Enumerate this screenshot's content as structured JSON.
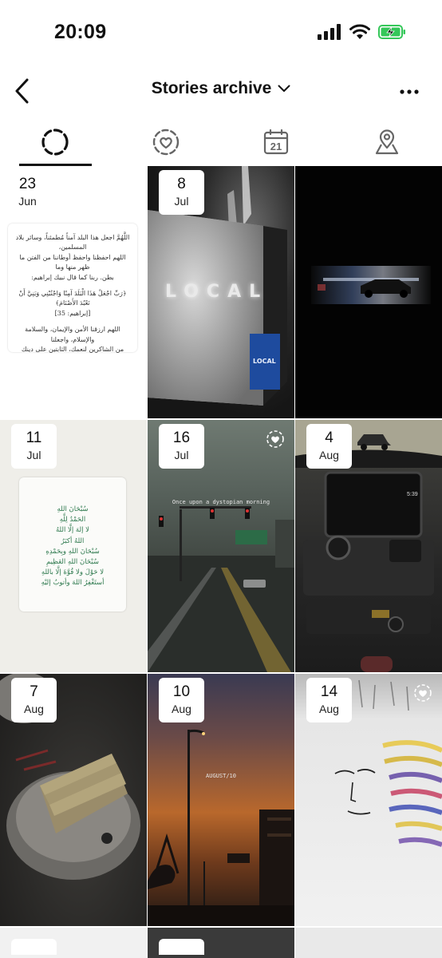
{
  "status_bar": {
    "time": "20:09"
  },
  "header": {
    "title": "Stories archive"
  },
  "tabs": [
    {
      "name": "stories",
      "icon": "dashed-circle-icon",
      "active": true
    },
    {
      "name": "likes",
      "icon": "heart-circle-icon",
      "active": false
    },
    {
      "name": "calendar",
      "icon": "calendar-icon",
      "active": false,
      "label": "21"
    },
    {
      "name": "map",
      "icon": "map-pin-icon",
      "active": false
    }
  ],
  "stories": [
    {
      "day": "23",
      "month": "Jun",
      "liked": false,
      "text_lines": [
        "اللَّهُمَّ اجعل هذا البلد آمناً مُطمئناً، وسائر بلاد المسلمين،",
        "اللهم احفظنا واحفظ أوطاننا من الفتن ما ظهر منها وما",
        "بطن. ربنا كما قال نبيك إبراهيم:",
        "﴿رَبِّ اجْعَلْ هَذَا الْبَلَدَ آمِنًا وَاجْنُبْنِي وَبَنِيَّ أَنْ نَعْبُدَ الأَصْنَامَ﴾",
        "[إبراهيم: 35]",
        "اللهم ارزقنا الأمن والإيمان، والسلامة والإسلام، واجعلنا",
        "من الشاكرين لنعمك، الثابتين على دينك"
      ]
    },
    {
      "day": "8",
      "month": "Jul",
      "liked": false,
      "sign_text": "LOCAL",
      "small_text": "LOCAL"
    },
    {
      "day": "",
      "month": "",
      "liked": false
    },
    {
      "day": "11",
      "month": "Jul",
      "liked": false,
      "text_lines": [
        "سُبْحَانَ اللهِ",
        "الحَمْدُ لِلَّهِ",
        "لا إلهَ إلَّا اللهُ",
        "اللهُ أكبَرُ",
        "سُبْحَانَ اللهِ وبِحَمْدِهِ",
        "سُبْحَانَ اللهِ العَظِيمِ",
        "لا حَوْلَ ولا قُوَّةَ إلَّا باللهِ",
        "أستَغْفِرُ اللهَ وأتوبُ إليْهِ"
      ]
    },
    {
      "day": "16",
      "month": "Jul",
      "liked": true,
      "caption": "Once upon a dystopian morning"
    },
    {
      "day": "4",
      "month": "Aug",
      "liked": false,
      "screen_text": "5:39"
    },
    {
      "day": "7",
      "month": "Aug",
      "liked": false
    },
    {
      "day": "10",
      "month": "Aug",
      "liked": false,
      "caption": "AUGUST/10"
    },
    {
      "day": "14",
      "month": "Aug",
      "liked": true
    },
    {
      "day": "",
      "month": "",
      "liked": false
    },
    {
      "day": "",
      "month": "",
      "liked": false
    },
    {
      "day": "",
      "month": "",
      "liked": false
    }
  ],
  "colors": {
    "active_tab_indicator": "#111111",
    "badge_bg": "#ffffff",
    "arabic_green": "#2f7a4f",
    "battery_green": "#34c759"
  }
}
